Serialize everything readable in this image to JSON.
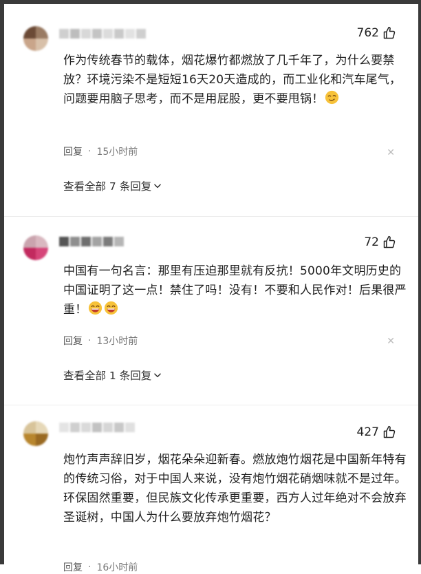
{
  "comments": [
    {
      "likes": "762",
      "text": "作为传统春节的载体，烟花爆竹都燃放了几千年了，为什么要禁放？环境污染不是短短16天20天造成的，而工业化和汽车尾气，问题要用脑子思考，而不是用屁股，更不要甩锅！",
      "emoji": "smirk-emoji",
      "reply_label": "回复",
      "time": "15小时前",
      "expand_label": "查看全部 7 条回复"
    },
    {
      "likes": "72",
      "text": "中国有一句名言：那里有压迫那里就有反抗！5000年文明历史的中国证明了这一点！禁住了吗！没有！不要和人民作对！后果很严重！",
      "emoji": "grin-emoji",
      "reply_label": "回复",
      "time": "13小时前",
      "expand_label": "查看全部 1 条回复"
    },
    {
      "likes": "427",
      "text": "炮竹声声辞旧岁，烟花朵朵迎新春。燃放炮竹烟花是中国新年特有的传统习俗，对于中国人来说，没有炮竹烟花硝烟味就不是过年。环保固然重要，但民族文化传承更重要，西方人过年绝对不会放弃圣诞树，中国人为什么要放弃炮竹烟花？",
      "reply_label": "回复",
      "time": "16小时前"
    }
  ],
  "colors": {
    "text": "#1f1f1f",
    "meta": "#555555",
    "frame": "#3a3a3a",
    "divider": "#ececec"
  },
  "icons": {
    "like": "thumbs-up-icon",
    "close": "close-icon",
    "expand": "chevron-down-icon"
  }
}
